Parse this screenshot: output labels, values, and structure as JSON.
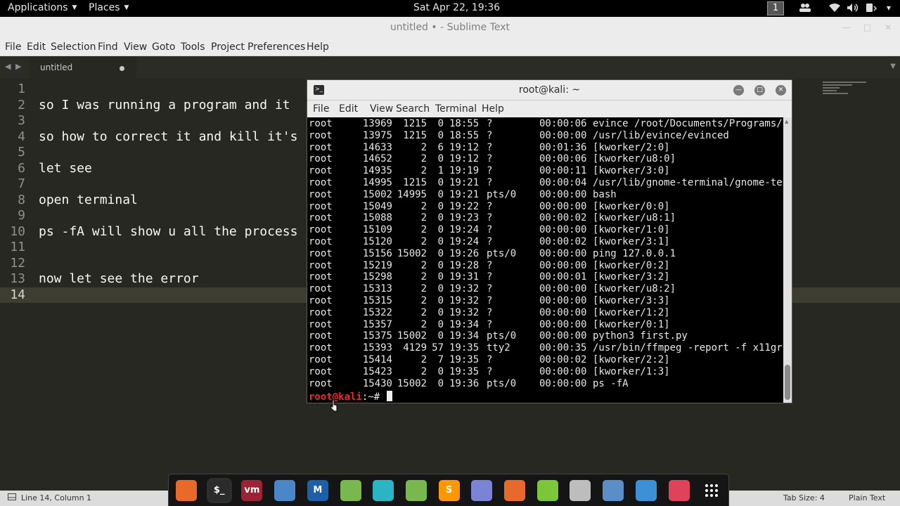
{
  "topbar": {
    "applications": "Applications",
    "places": "Places",
    "clock": "Sat Apr 22, 19:36",
    "workspace": "1",
    "tray_icons": [
      "people-icon",
      "wifi-icon",
      "volume-icon",
      "power-icon"
    ]
  },
  "sublime": {
    "title": "untitled • - Sublime Text",
    "menu": [
      "File",
      "Edit",
      "Selection",
      "Find",
      "View",
      "Goto",
      "Tools",
      "Project",
      "Preferences",
      "Help"
    ],
    "tab_label": "untitled",
    "lines": [
      {
        "num": "1",
        "text": ""
      },
      {
        "num": "2",
        "text": "so I was running a program and it"
      },
      {
        "num": "3",
        "text": ""
      },
      {
        "num": "4",
        "text": "so how to correct it and kill it's"
      },
      {
        "num": "5",
        "text": ""
      },
      {
        "num": "6",
        "text": "let see"
      },
      {
        "num": "7",
        "text": ""
      },
      {
        "num": "8",
        "text": "open terminal"
      },
      {
        "num": "9",
        "text": ""
      },
      {
        "num": "10",
        "text": "ps -fA will show u all the process"
      },
      {
        "num": "11",
        "text": ""
      },
      {
        "num": "12",
        "text": ""
      },
      {
        "num": "13",
        "text": "now let see the error"
      },
      {
        "num": "14",
        "text": ""
      }
    ],
    "status_left": "Line 14, Column 1",
    "status_tab": "Tab Size: 4",
    "status_syntax": "Plain Text"
  },
  "terminal": {
    "title": "root@kali: ~",
    "menu": [
      "File",
      "Edit",
      "View",
      "Search",
      "Terminal",
      "Help"
    ],
    "rows": [
      {
        "uid": "root",
        "pid": "13969",
        "ppid": "1215",
        "c": "0",
        "stime": "18:55",
        "tty": "?",
        "time": "00:00:06",
        "cmd": "evince /root/Documents/Programs/"
      },
      {
        "uid": "root",
        "pid": "13975",
        "ppid": "1215",
        "c": "0",
        "stime": "18:55",
        "tty": "?",
        "time": "00:00:00",
        "cmd": "/usr/lib/evince/evinced"
      },
      {
        "uid": "root",
        "pid": "14633",
        "ppid": "2",
        "c": "6",
        "stime": "19:12",
        "tty": "?",
        "time": "00:01:36",
        "cmd": "[kworker/2:0]"
      },
      {
        "uid": "root",
        "pid": "14652",
        "ppid": "2",
        "c": "0",
        "stime": "19:12",
        "tty": "?",
        "time": "00:00:06",
        "cmd": "[kworker/u8:0]"
      },
      {
        "uid": "root",
        "pid": "14935",
        "ppid": "2",
        "c": "1",
        "stime": "19:19",
        "tty": "?",
        "time": "00:00:11",
        "cmd": "[kworker/3:0]"
      },
      {
        "uid": "root",
        "pid": "14995",
        "ppid": "1215",
        "c": "0",
        "stime": "19:21",
        "tty": "?",
        "time": "00:00:04",
        "cmd": "/usr/lib/gnome-terminal/gnome-te"
      },
      {
        "uid": "root",
        "pid": "15002",
        "ppid": "14995",
        "c": "0",
        "stime": "19:21",
        "tty": "pts/0",
        "time": "00:00:00",
        "cmd": "bash"
      },
      {
        "uid": "root",
        "pid": "15049",
        "ppid": "2",
        "c": "0",
        "stime": "19:22",
        "tty": "?",
        "time": "00:00:00",
        "cmd": "[kworker/0:0]"
      },
      {
        "uid": "root",
        "pid": "15088",
        "ppid": "2",
        "c": "0",
        "stime": "19:23",
        "tty": "?",
        "time": "00:00:02",
        "cmd": "[kworker/u8:1]"
      },
      {
        "uid": "root",
        "pid": "15109",
        "ppid": "2",
        "c": "0",
        "stime": "19:24",
        "tty": "?",
        "time": "00:00:00",
        "cmd": "[kworker/1:0]"
      },
      {
        "uid": "root",
        "pid": "15120",
        "ppid": "2",
        "c": "0",
        "stime": "19:24",
        "tty": "?",
        "time": "00:00:02",
        "cmd": "[kworker/3:1]"
      },
      {
        "uid": "root",
        "pid": "15156",
        "ppid": "15002",
        "c": "0",
        "stime": "19:26",
        "tty": "pts/0",
        "time": "00:00:00",
        "cmd": "ping 127.0.0.1"
      },
      {
        "uid": "root",
        "pid": "15219",
        "ppid": "2",
        "c": "0",
        "stime": "19:28",
        "tty": "?",
        "time": "00:00:00",
        "cmd": "[kworker/0:2]"
      },
      {
        "uid": "root",
        "pid": "15298",
        "ppid": "2",
        "c": "0",
        "stime": "19:31",
        "tty": "?",
        "time": "00:00:01",
        "cmd": "[kworker/3:2]"
      },
      {
        "uid": "root",
        "pid": "15313",
        "ppid": "2",
        "c": "0",
        "stime": "19:32",
        "tty": "?",
        "time": "00:00:00",
        "cmd": "[kworker/u8:2]"
      },
      {
        "uid": "root",
        "pid": "15315",
        "ppid": "2",
        "c": "0",
        "stime": "19:32",
        "tty": "?",
        "time": "00:00:00",
        "cmd": "[kworker/3:3]"
      },
      {
        "uid": "root",
        "pid": "15322",
        "ppid": "2",
        "c": "0",
        "stime": "19:32",
        "tty": "?",
        "time": "00:00:00",
        "cmd": "[kworker/1:2]"
      },
      {
        "uid": "root",
        "pid": "15357",
        "ppid": "2",
        "c": "0",
        "stime": "19:34",
        "tty": "?",
        "time": "00:00:00",
        "cmd": "[kworker/0:1]"
      },
      {
        "uid": "root",
        "pid": "15375",
        "ppid": "15002",
        "c": "0",
        "stime": "19:34",
        "tty": "pts/0",
        "time": "00:00:00",
        "cmd": "python3 first.py"
      },
      {
        "uid": "root",
        "pid": "15393",
        "ppid": "4129",
        "c": "57",
        "stime": "19:35",
        "tty": "tty2",
        "time": "00:00:35",
        "cmd": "/usr/bin/ffmpeg -report -f x11gr"
      },
      {
        "uid": "root",
        "pid": "15414",
        "ppid": "2",
        "c": "7",
        "stime": "19:35",
        "tty": "?",
        "time": "00:00:02",
        "cmd": "[kworker/2:2]"
      },
      {
        "uid": "root",
        "pid": "15423",
        "ppid": "2",
        "c": "0",
        "stime": "19:35",
        "tty": "?",
        "time": "00:00:00",
        "cmd": "[kworker/1:3]"
      },
      {
        "uid": "root",
        "pid": "15430",
        "ppid": "15002",
        "c": "0",
        "stime": "19:36",
        "tty": "pts/0",
        "time": "00:00:00",
        "cmd": "ps -fA"
      }
    ],
    "prompt_user": "root@kali",
    "prompt_rest": ":~# "
  },
  "dock": {
    "apps": [
      {
        "name": "firefox",
        "label": "",
        "color": "#e8692a"
      },
      {
        "name": "terminal",
        "label": "$_",
        "color": "#2b2b2b"
      },
      {
        "name": "vmware",
        "label": "vm",
        "color": "#9b2335"
      },
      {
        "name": "files",
        "label": "",
        "color": "#4a86c8"
      },
      {
        "name": "metasploit",
        "label": "M",
        "color": "#1d5fa8"
      },
      {
        "name": "android-tool-1",
        "label": "",
        "color": "#78b84d"
      },
      {
        "name": "character-app",
        "label": "",
        "color": "#2bb5c4"
      },
      {
        "name": "android-tool-2",
        "label": "",
        "color": "#78b84d"
      },
      {
        "name": "sublime-text",
        "label": "S",
        "color": "#ff9800"
      },
      {
        "name": "text-editor",
        "label": "",
        "color": "#7b83d6"
      },
      {
        "name": "burp-suite",
        "label": "",
        "color": "#e66a2c"
      },
      {
        "name": "document-viewer",
        "label": "",
        "color": "#7cc63b"
      },
      {
        "name": "keyboard-app",
        "label": "",
        "color": "#bdbdbd"
      },
      {
        "name": "network-app",
        "label": "",
        "color": "#5b8ec9"
      },
      {
        "name": "screenshot-app",
        "label": "",
        "color": "#3d8fd6"
      },
      {
        "name": "glasses-app",
        "label": "",
        "color": "#e0415b"
      },
      {
        "name": "show-apps",
        "label": "",
        "color": "#151515"
      }
    ]
  }
}
